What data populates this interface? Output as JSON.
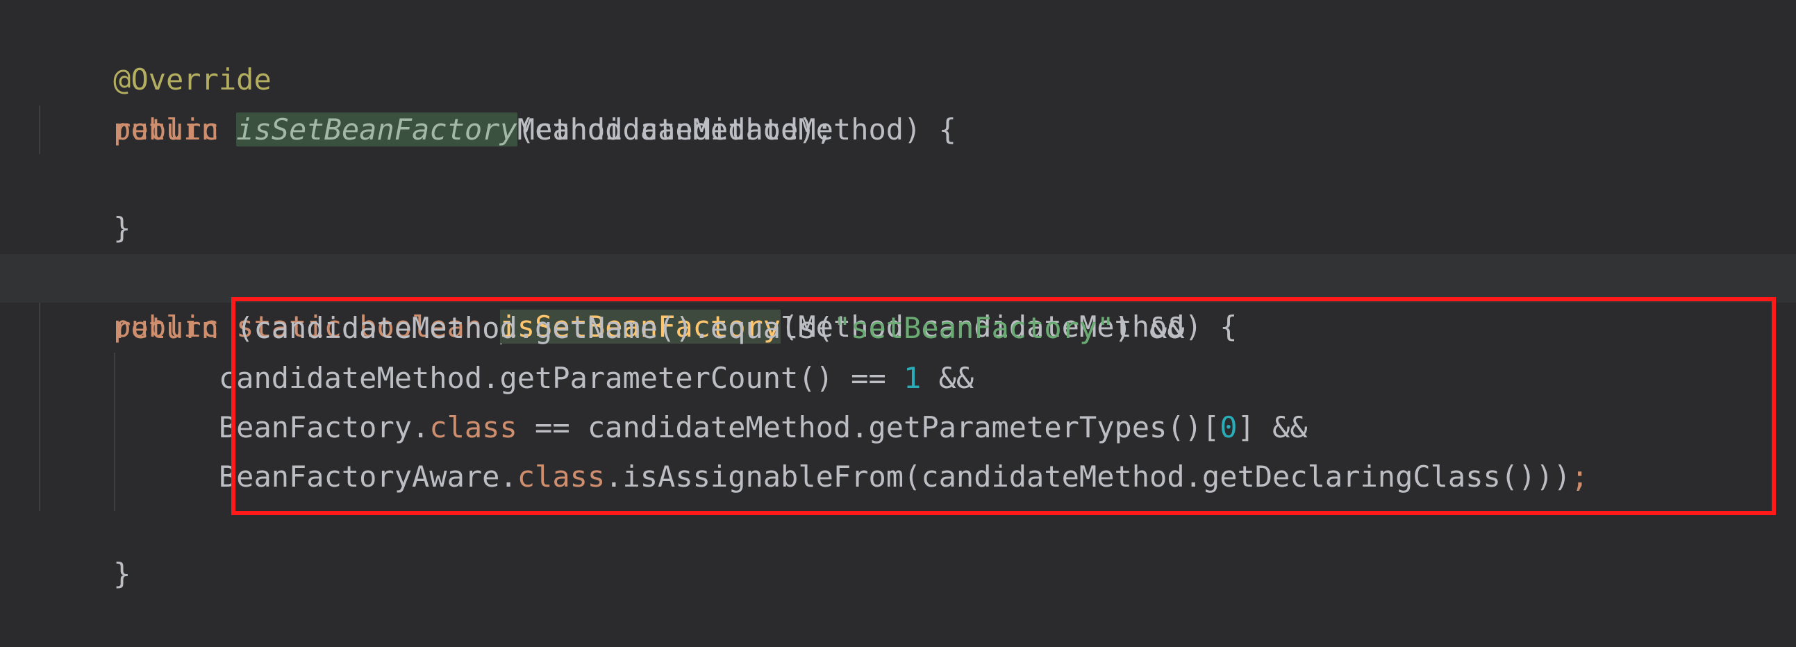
{
  "code": {
    "annotation": "@Override",
    "line2": {
      "kw_public": "public",
      "kw_boolean": "boolean",
      "method_name": "isMatch",
      "params": "(Method candidateMethod) {"
    },
    "line3": {
      "kw_return": "return",
      "call_name": "isSetBeanFactory",
      "args": "(candidateMethod);"
    },
    "line4": "}",
    "line6": {
      "kw_public": "public",
      "kw_static": "static",
      "kw_boolean": "boolean",
      "method_name": "isSetBeanFactory",
      "params": "(Method candidateMethod) {"
    },
    "line7": {
      "kw_return": "return",
      "part1": " (candidateMethod.getName().equals(",
      "string": "\"setBeanFactory\"",
      "part2": ") &&"
    },
    "line8": {
      "part1": "candidateMethod.getParameterCount() == ",
      "number": "1",
      "part2": " &&"
    },
    "line9": {
      "part1": "BeanFactory.",
      "kw_class": "class",
      "part2": " == candidateMethod.getParameterTypes()[",
      "number": "0",
      "part3": "] &&"
    },
    "line10": {
      "part1": "BeanFactoryAware.",
      "kw_class": "class",
      "part2": ".isAssignableFrom(candidateMethod.getDeclaringClass()))",
      "semicolon": ";"
    },
    "line11": "}"
  },
  "colors": {
    "background": "#2b2b2d",
    "keyword": "#cf8e6d",
    "annotation": "#b3ae60",
    "declaration": "#ffc66d",
    "string": "#6aab73",
    "number": "#2aacb8",
    "highlight_box": "#ff1a1a"
  }
}
